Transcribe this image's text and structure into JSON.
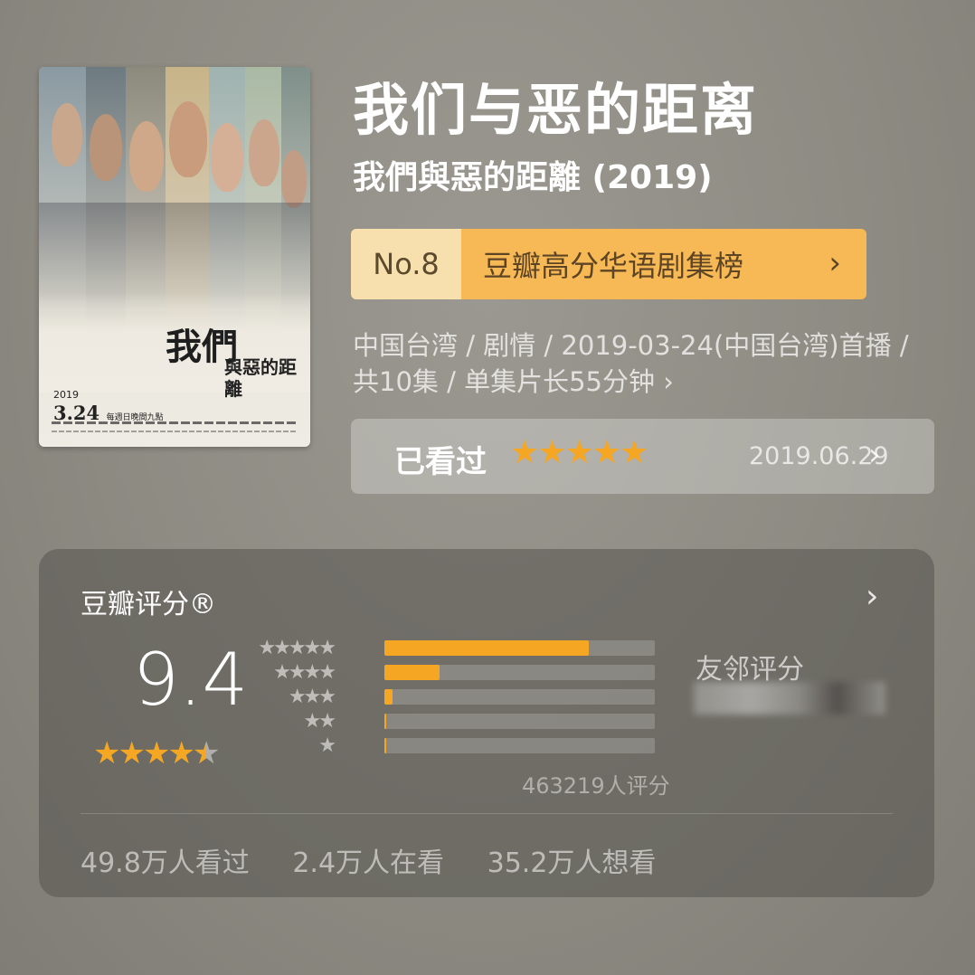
{
  "poster": {
    "title_big": "我們",
    "title_small": "與惡的距離",
    "date_year": "2019",
    "date_day": "3.24",
    "date_note": "每週日晚間九點"
  },
  "title": {
    "main": "我们与恶的距离",
    "original": "我們與惡的距離 (2019)"
  },
  "rank": {
    "number": "No.8",
    "list_name": "豆瓣高分华语剧集榜",
    "chevron": "›"
  },
  "meta": {
    "line1": "中国台湾 / 剧情 / 2019-03-24(中国台湾)首播 /",
    "line2": "共10集 / 单集片长55分钟 ›"
  },
  "watched": {
    "label": "已看过",
    "stars": "★★★★★",
    "rating_value": 5,
    "date": "2019.06.29",
    "chevron": "›"
  },
  "rating": {
    "header": "豆瓣评分®",
    "chevron": "›",
    "score": "9.4",
    "stars_value": 4.7,
    "distribution": [
      {
        "stars": "★★★★★",
        "percent": 75.6
      },
      {
        "stars": "★★★★",
        "percent": 20.4
      },
      {
        "stars": "★★★",
        "percent": 3.1
      },
      {
        "stars": "★★",
        "percent": 0.5
      },
      {
        "stars": "★",
        "percent": 0.4
      }
    ],
    "count": "463219人评分",
    "friends_label": "友邻评分"
  },
  "stats": {
    "watched": "49.8万人看过",
    "watching": "2.4万人在看",
    "want": "35.2万人想看"
  },
  "colors": {
    "accent": "#f5a623",
    "rank_light": "#f8dfae",
    "rank_dark": "#f7b955"
  }
}
